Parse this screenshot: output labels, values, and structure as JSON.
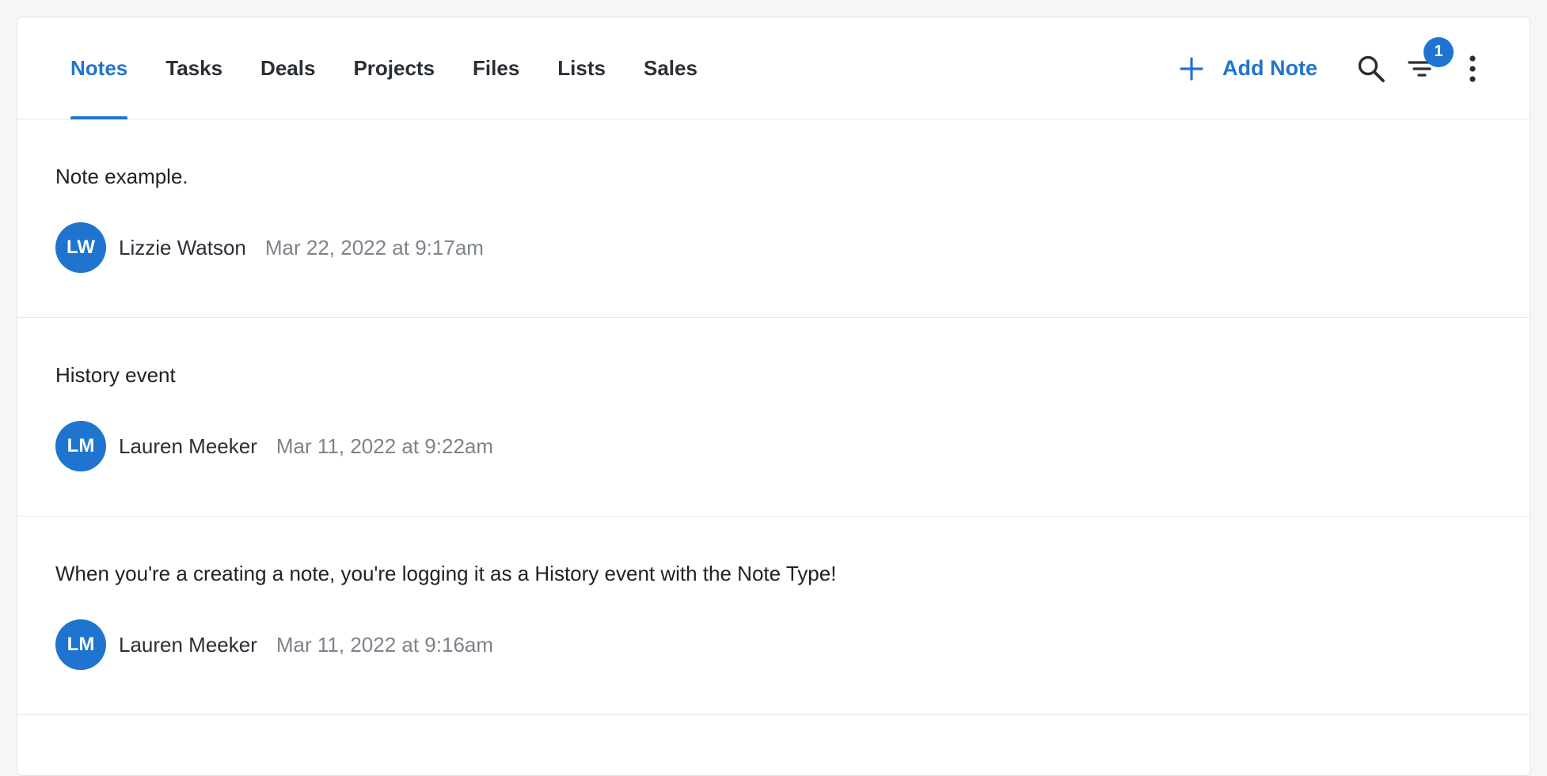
{
  "tabs": [
    {
      "label": "Notes",
      "active": true
    },
    {
      "label": "Tasks",
      "active": false
    },
    {
      "label": "Deals",
      "active": false
    },
    {
      "label": "Projects",
      "active": false
    },
    {
      "label": "Files",
      "active": false
    },
    {
      "label": "Lists",
      "active": false
    },
    {
      "label": "Sales",
      "active": false
    }
  ],
  "toolbar": {
    "add_note_label": "Add Note",
    "filter_badge_count": "1",
    "icons": [
      "plus-icon",
      "search-icon",
      "filter-icon",
      "more-vertical-icon"
    ]
  },
  "notes": [
    {
      "text": "Note example.",
      "author_initials": "LW",
      "author": "Lizzie Watson",
      "timestamp": "Mar 22, 2022 at 9:17am"
    },
    {
      "text": "History event",
      "author_initials": "LM",
      "author": "Lauren Meeker",
      "timestamp": "Mar 11, 2022 at 9:22am"
    },
    {
      "text": "When you're a creating a note, you're logging it as a History event with the Note Type!",
      "author_initials": "LM",
      "author": "Lauren Meeker",
      "timestamp": "Mar 11, 2022 at 9:16am"
    }
  ],
  "colors": {
    "accent": "#1f74d0",
    "text": "#222222",
    "muted": "#7d838b",
    "border": "#e6e8eb"
  }
}
